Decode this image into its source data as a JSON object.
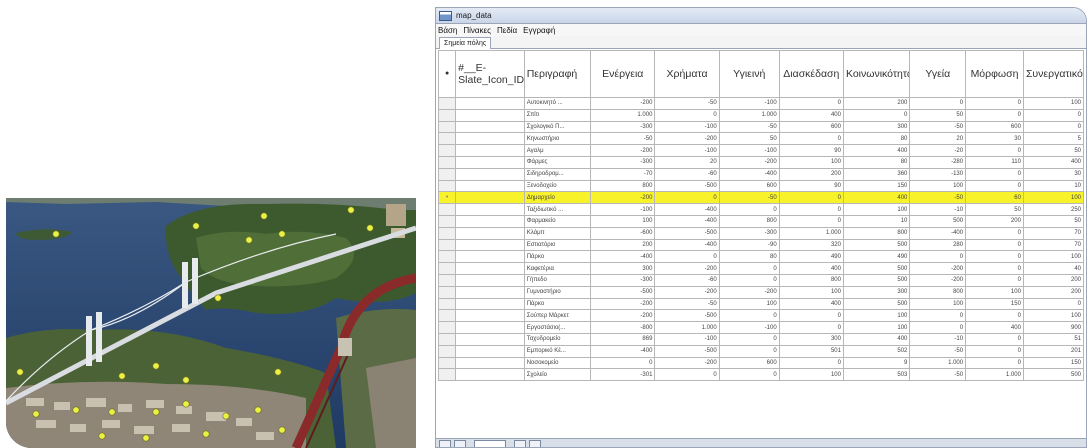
{
  "window": {
    "title": "map_data",
    "menu": [
      "Βάση",
      "Πίνακες",
      "Πεδία",
      "Εγγραφή"
    ],
    "tab_label": "Σημεία πόλης"
  },
  "table": {
    "selector_header": "●",
    "columns": [
      "#__E-Slate_Icon_ID__#",
      "Περιγραφή",
      "Ενέργεια",
      "Χρήματα",
      "Υγιεινή",
      "Διασκέδαση",
      "Κοινωνικότητα",
      "Υγεία",
      "Μόρφωση",
      "Συνεργατικότητα"
    ],
    "rows": [
      {
        "desc": "Αυτοκινητό ...",
        "vals": [
          "-200",
          "-50",
          "-100",
          "0",
          "200",
          "0",
          "0",
          "100"
        ]
      },
      {
        "desc": "Σπίτι",
        "vals": [
          "1.000",
          "0",
          "1.000",
          "400",
          "0",
          "50",
          "0",
          "0"
        ]
      },
      {
        "desc": "Σχολογικό Π...",
        "vals": [
          "-300",
          "-100",
          "-50",
          "600",
          "300",
          "-50",
          "600",
          "0"
        ]
      },
      {
        "desc": "Κηνωστήριο",
        "vals": [
          "-50",
          "-200",
          "50",
          "0",
          "80",
          "20",
          "30",
          "5"
        ]
      },
      {
        "desc": "Αγαλμ",
        "vals": [
          "-200",
          "-100",
          "-100",
          "90",
          "400",
          "-20",
          "0",
          "50"
        ]
      },
      {
        "desc": "Φάρμες",
        "vals": [
          "-300",
          "20",
          "-200",
          "100",
          "80",
          "-280",
          "110",
          "400"
        ]
      },
      {
        "desc": "Σιδηροδρομ...",
        "vals": [
          "-70",
          "-60",
          "-400",
          "200",
          "360",
          "-130",
          "0",
          "30"
        ]
      },
      {
        "desc": "Ξενοδοχείο",
        "vals": [
          "800",
          "-500",
          "600",
          "90",
          "150",
          "100",
          "0",
          "10"
        ]
      },
      {
        "desc": "Δημαρχείο",
        "vals": [
          "-200",
          "0",
          "-50",
          "0",
          "400",
          "-50",
          "60",
          "100"
        ],
        "highlight": true
      },
      {
        "desc": "Ταξιδιωτικό ...",
        "vals": [
          "-100",
          "-400",
          "0",
          "0",
          "100",
          "-10",
          "50",
          "250"
        ]
      },
      {
        "desc": "Φαρμακείο",
        "vals": [
          "100",
          "-400",
          "800",
          "0",
          "10",
          "500",
          "200",
          "50"
        ]
      },
      {
        "desc": "Κλάμπ",
        "vals": [
          "-600",
          "-500",
          "-300",
          "1.000",
          "800",
          "-400",
          "0",
          "70"
        ]
      },
      {
        "desc": "Εστιατόριο",
        "vals": [
          "200",
          "-400",
          "-90",
          "320",
          "500",
          "280",
          "0",
          "70"
        ]
      },
      {
        "desc": "Πάρκο",
        "vals": [
          "-400",
          "0",
          "80",
          "490",
          "490",
          "0",
          "0",
          "100"
        ]
      },
      {
        "desc": "Καφετέρια",
        "vals": [
          "300",
          "-200",
          "0",
          "400",
          "500",
          "-200",
          "0",
          "40"
        ]
      },
      {
        "desc": "Γήπεδο",
        "vals": [
          "-300",
          "-60",
          "0",
          "800",
          "500",
          "-200",
          "0",
          "200"
        ]
      },
      {
        "desc": "Γυμναστήριο",
        "vals": [
          "-500",
          "-200",
          "-200",
          "100",
          "300",
          "800",
          "100",
          "200"
        ]
      },
      {
        "desc": "Πάρκο",
        "vals": [
          "-200",
          "-50",
          "100",
          "400",
          "500",
          "100",
          "150",
          "0"
        ]
      },
      {
        "desc": "Σούπερ Μάρκετ",
        "vals": [
          "-200",
          "-500",
          "0",
          "0",
          "100",
          "0",
          "0",
          "100"
        ]
      },
      {
        "desc": "Εργοστάσιο(...",
        "vals": [
          "-800",
          "1.000",
          "-100",
          "0",
          "100",
          "0",
          "400",
          "900"
        ]
      },
      {
        "desc": "Ταχυδρομείο",
        "vals": [
          "869",
          "-100",
          "0",
          "300",
          "400",
          "-10",
          "0",
          "51"
        ]
      },
      {
        "desc": "Εμπορικό Κέ...",
        "vals": [
          "-400",
          "-500",
          "0",
          "501",
          "502",
          "-50",
          "0",
          "201"
        ]
      },
      {
        "desc": "Νοσοκομείο",
        "vals": [
          "0",
          "-200",
          "600",
          "0",
          "9",
          "1.000",
          "0",
          "150"
        ]
      },
      {
        "desc": "Σχολείο",
        "vals": [
          "-301",
          "0",
          "0",
          "100",
          "503",
          "-50",
          "1.000",
          "500"
        ]
      }
    ]
  },
  "colors": {
    "highlight": "#f7f22a",
    "water": "#2f4f7a",
    "bridge_red": "#8a2a2a",
    "marker": "#e9f046"
  },
  "icons": {
    "app": "table-app-icon",
    "record_marker": "record-marker-icon"
  }
}
